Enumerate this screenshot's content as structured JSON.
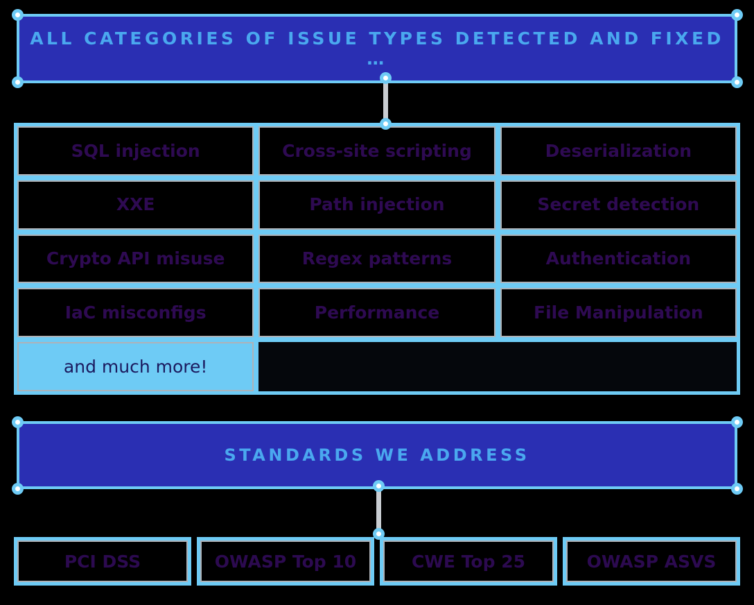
{
  "canvas": {
    "background": "#000000",
    "accent_blue": "#6ecbf5",
    "banner_fill": "#2a2fb3",
    "banner_text_color": "#4aa8ef",
    "cell_text_color": "#2e0a52",
    "highlight_fill": "#6ecbf5",
    "highlight_text_color": "#1b1a5e"
  },
  "banners": {
    "top": {
      "title": "ALL CATEGORIES OF ISSUE TYPES DETECTED AND FIXED …"
    },
    "standards": {
      "title": "STANDARDS WE ADDRESS"
    }
  },
  "issue_grid": {
    "columns": 3,
    "rows": [
      [
        "SQL injection",
        "Cross-site scripting",
        "Deserialization"
      ],
      [
        "XXE",
        "Path injection",
        "Secret detection"
      ],
      [
        "Crypto API misuse",
        "Regex patterns",
        "Authentication"
      ],
      [
        "IaC misconfigs",
        "Performance",
        "File Manipulation"
      ]
    ],
    "footer_cell": {
      "label": "and much more!",
      "highlighted": true
    }
  },
  "standards": {
    "items": [
      "PCI DSS",
      "OWASP Top 10",
      "CWE Top 25",
      "OWASP ASVS"
    ]
  }
}
